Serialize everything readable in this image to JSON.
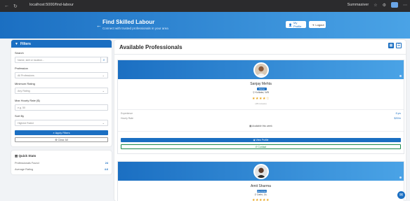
{
  "browser": {
    "url": "localhost:5000/find-labour",
    "account": "Summasiver",
    "nav_icons": [
      "back-icon",
      "refresh-icon"
    ]
  },
  "header": {
    "back_glyph": "←",
    "title": "Find Skilled Labour",
    "subtitle": "Connect with trusted professionals in your area",
    "profile_label": "My Profile",
    "logout_label": "Logout"
  },
  "filters": {
    "title": "Filters",
    "search_label": "Search",
    "search_placeholder": "Name, skill or location...",
    "profession_label": "Profession",
    "profession_value": "All Professions",
    "rating_label": "Minimum Rating",
    "rating_value": "Any Rating",
    "rate_label": "Max Hourly Rate ($)",
    "rate_placeholder": "e.g. 50",
    "sort_label": "Sort By",
    "sort_value": "Highest Rated",
    "apply_label": "Apply Filters",
    "clear_label": "Clear All"
  },
  "stats": {
    "title": "Quick Stats",
    "rows": [
      {
        "label": "Professionals Found",
        "value": "24"
      },
      {
        "label": "Average Rating",
        "value": "4.6"
      }
    ]
  },
  "main": {
    "title": "Available Professionals"
  },
  "professionals": [
    {
      "name": "Sanjay Mehta",
      "badge": "Painter",
      "location": "Kolkata, WB",
      "stars": "★★★★☆",
      "rating": 4.5,
      "reviews": "(48 reviews)",
      "experience_label": "Experience",
      "experience_value": "8 yrs",
      "rate_label": "Hourly Rate",
      "rate_value": "$20/hr",
      "availability": "Available this week",
      "view_label": "View Profile",
      "contact_label": "Contact"
    },
    {
      "name": "Amit Sharma",
      "badge": "Electrician",
      "location": "Delhi, DL",
      "stars": "★★★★★",
      "rating": 5
    }
  ],
  "colors": {
    "primary": "#1b6fc2",
    "accent": "#4aa3e6",
    "success": "#1b8a4c",
    "star": "#e8a317"
  }
}
